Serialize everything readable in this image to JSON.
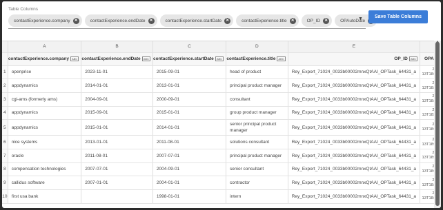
{
  "table_columns": {
    "label": "Table Columns",
    "chips": [
      {
        "label": "contactExperience.company",
        "remove_icon": "close-circle-icon"
      },
      {
        "label": "contactExperience.endDate",
        "remove_icon": "close-circle-icon"
      },
      {
        "label": "contactExperience.startDate",
        "remove_icon": "close-circle-icon"
      },
      {
        "label": "contactExperience.title",
        "remove_icon": "close-circle-icon"
      },
      {
        "label": "OP_ID",
        "remove_icon": "close-circle-icon"
      },
      {
        "label": "OPAutoDate",
        "remove_icon": "close-circle-icon"
      }
    ],
    "dropdown_icon": "caret-down-icon",
    "chip_remove_glyph": "✕",
    "dropdown_glyph": "▼"
  },
  "save_button": {
    "label": "Save Table Columns",
    "color": "#3b7dd8"
  },
  "grid": {
    "column_letters": [
      "A",
      "B",
      "C",
      "D",
      "E",
      "F"
    ],
    "column_names": [
      "contactExperience.company",
      "contactExperience.endDate",
      "contactExperience.startDate",
      "contactExperience.title",
      "OP_ID",
      "OPAut"
    ],
    "type_badge": "ABC",
    "rows": [
      {
        "n": "1",
        "company": "openprise",
        "end": "2023-11-01",
        "start": "2015-09-01",
        "title": "head of product",
        "opid": "Rey_Export_71024_0033b00002mnxQtAAI_OPTask_64431_a",
        "opa1": "202",
        "opa2": "13T18:39"
      },
      {
        "n": "2",
        "company": "appdynamics",
        "end": "2014-01-01",
        "start": "2013-01-01",
        "title": "principal product manager",
        "opid": "Rey_Export_71024_0033b00002mnxQtAAI_OPTask_64431_a",
        "opa1": "202",
        "opa2": "13T18:39"
      },
      {
        "n": "3",
        "company": "cgi-ams (formerly ams)",
        "end": "2004-09-01",
        "start": "2000-09-01",
        "title": "consultant",
        "opid": "Rey_Export_71024_0033b00002mnxQtAAI_OPTask_64431_a",
        "opa1": "202",
        "opa2": "13T18:39"
      },
      {
        "n": "4",
        "company": "appdynamics",
        "end": "2015-09-01",
        "start": "2015-01-01",
        "title": "group product manager",
        "opid": "Rey_Export_71024_0033b00002mnxQtAAI_OPTask_64431_a",
        "opa1": "202",
        "opa2": "13T18:39"
      },
      {
        "n": "5",
        "company": "appdynamics",
        "end": "2015-01-01",
        "start": "2014-01-01",
        "title": "senior principal product manager",
        "opid": "Rey_Export_71024_0033b00002mnxQtAAI_OPTask_64431_a",
        "opa1": "202",
        "opa2": "13T18:39"
      },
      {
        "n": "6",
        "company": "nice systems",
        "end": "2013-01-01",
        "start": "2011-08-01",
        "title": "solutions consultant",
        "opid": "Rey_Export_71024_0033b00002mnxQtAAI_OPTask_64431_a",
        "opa1": "202",
        "opa2": "13T18:39"
      },
      {
        "n": "7",
        "company": "oracle",
        "end": "2011-08-01",
        "start": "2007-07-01",
        "title": "principal product manager",
        "opid": "Rey_Export_71024_0033b00002mnxQtAAI_OPTask_64431_a",
        "opa1": "202",
        "opa2": "13T18:39"
      },
      {
        "n": "8",
        "company": "compensation technologies",
        "end": "2007-07-01",
        "start": "2004-09-01",
        "title": "senior consultant",
        "opid": "Rey_Export_71024_0033b00002mnxQtAAI_OPTask_64431_a",
        "opa1": "202",
        "opa2": "13T18:39"
      },
      {
        "n": "9",
        "company": "callidus software",
        "end": "2007-01-01",
        "start": "2004-01-01",
        "title": "contractor",
        "opid": "Rey_Export_71024_0033b00002mnxQtAAI_OPTask_64431_a",
        "opa1": "202",
        "opa2": "13T18:39"
      },
      {
        "n": "10",
        "company": "first usa bank",
        "end": "",
        "start": "1998-01-01",
        "title": "intern",
        "opid": "Rey_Export_71024_0033b00002mnxQtAAI_OPTask_64431_a",
        "opa1": "202",
        "opa2": "13T18:39"
      }
    ]
  },
  "scrollbar": {
    "up_icon": "scroll-up-icon"
  }
}
